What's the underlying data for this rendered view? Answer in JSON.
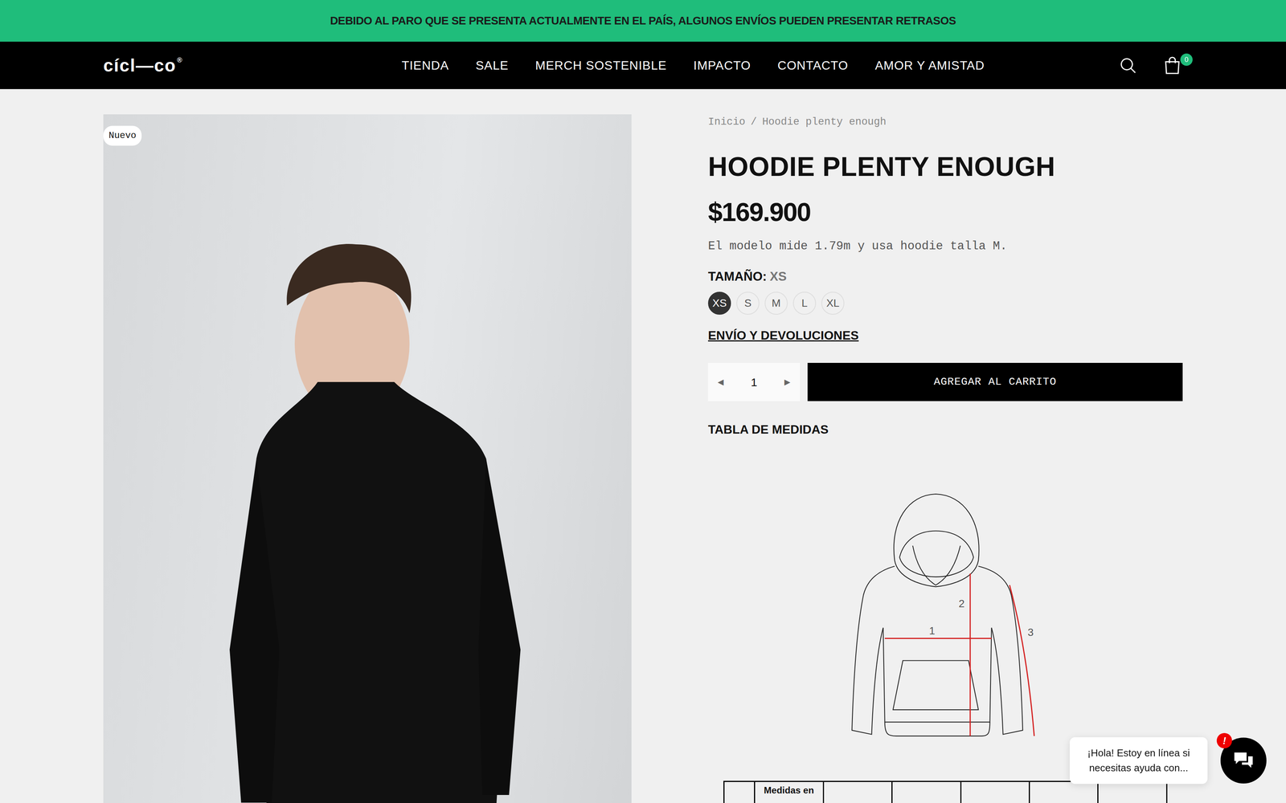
{
  "banner": {
    "text": "DEBIDO AL PARO QUE SE PRESENTA ACTUALMENTE EN EL PAÍS, ALGUNOS ENVÍOS PUEDEN PRESENTAR RETRASOS"
  },
  "nav": {
    "logo": "cícl—co",
    "logo_mark": "®",
    "items": [
      {
        "label": "TIENDA"
      },
      {
        "label": "SALE"
      },
      {
        "label": "MERCH SOSTENIBLE"
      },
      {
        "label": "IMPACTO"
      },
      {
        "label": "CONTACTO"
      },
      {
        "label": "AMOR Y AMISTAD"
      }
    ],
    "cart_count": "0"
  },
  "gallery": {
    "badge": "Nuevo"
  },
  "product": {
    "breadcrumb": [
      "Inicio",
      "/",
      "Hoodie plenty enough"
    ],
    "title": "HOODIE PLENTY ENOUGH",
    "price": "$169.900",
    "note": "El modelo mide 1.79m y usa hoodie talla M.",
    "size_label": "TAMAÑO:",
    "size_value": "XS",
    "sizes": [
      {
        "label": "XS",
        "selected": true
      },
      {
        "label": "S",
        "selected": false
      },
      {
        "label": "M",
        "selected": false
      },
      {
        "label": "L",
        "selected": false
      },
      {
        "label": "XL",
        "selected": false
      }
    ],
    "shipping_link": "ENVÍO Y DEVOLUCIONES",
    "qty_prev": "◄",
    "quantity": "1",
    "qty_next": "►",
    "add_button": "AGREGAR AL CARRITO",
    "size_chart_title": "TABLA DE MEDIDAS",
    "diagram_labels": [
      "1",
      "2",
      "3"
    ],
    "table_header": "Medidas en"
  },
  "chat": {
    "message": "¡Hola! Estoy en línea si necesitas ayuda con...",
    "alert": "!"
  }
}
